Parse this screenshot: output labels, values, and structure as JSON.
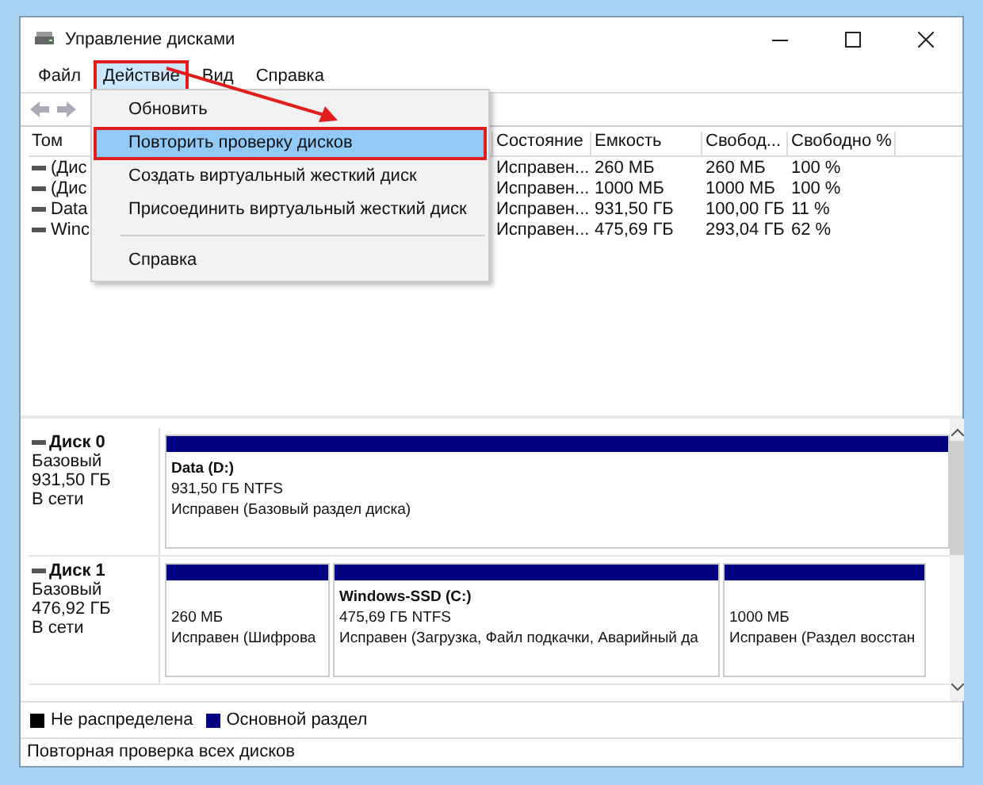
{
  "window": {
    "title": "Управление дисками"
  },
  "menu": [
    {
      "label": "Файл",
      "selected": false,
      "highlighted": false
    },
    {
      "label": "Действие",
      "selected": true,
      "highlighted": true
    },
    {
      "label": "Вид",
      "selected": false,
      "highlighted": false
    },
    {
      "label": "Справка",
      "selected": false,
      "highlighted": false
    }
  ],
  "dropdown": [
    {
      "kind": "item",
      "label": "Обновить",
      "selected": false,
      "highlighted": false
    },
    {
      "kind": "item",
      "label": "Повторить проверку дисков",
      "selected": true,
      "highlighted": true
    },
    {
      "kind": "item",
      "label": "Создать виртуальный жесткий диск",
      "selected": false,
      "highlighted": false
    },
    {
      "kind": "item",
      "label": "Присоединить виртуальный жесткий диск",
      "selected": false,
      "highlighted": false
    },
    {
      "kind": "separator"
    },
    {
      "kind": "item",
      "label": "Справка",
      "selected": false,
      "highlighted": false
    }
  ],
  "table": {
    "columns": [
      "Том",
      "Состояние",
      "Емкость",
      "Свобод...",
      "Свободно %"
    ],
    "rows": [
      [
        "(Дис",
        "Исправен...",
        "260 МБ",
        "260 МБ",
        "100 %"
      ],
      [
        "(Дис",
        "Исправен...",
        "1000 МБ",
        "1000 МБ",
        "100 %"
      ],
      [
        "Data",
        "Исправен...",
        "931,50 ГБ",
        "100,00 ГБ",
        "11 %"
      ],
      [
        "Winc",
        "Исправен...",
        "475,69 ГБ",
        "293,04 ГБ",
        "62 %"
      ]
    ]
  },
  "disks": [
    {
      "name": "Диск 0",
      "type": "Базовый",
      "size": "931,50 ГБ",
      "status": "В сети",
      "partitions": [
        {
          "title": "Data  (D:)",
          "size": "931,50 ГБ NTFS",
          "status": "Исправен (Базовый раздел диска)"
        }
      ]
    },
    {
      "name": "Диск 1",
      "type": "Базовый",
      "size": "476,92 ГБ",
      "status": "В сети",
      "partitions": [
        {
          "size": "260 МБ",
          "status": "Исправен (Шифрова"
        },
        {
          "title": "Windows-SSD  (C:)",
          "size": "475,69 ГБ NTFS",
          "status": "Исправен (Загрузка, Файл подкачки, Аварийный да"
        },
        {
          "size": "1000 МБ",
          "status": "Исправен (Раздел восстан"
        }
      ]
    }
  ],
  "legend": [
    {
      "label": "Не распределена",
      "color": "#000000"
    },
    {
      "label": "Основной раздел",
      "color": "#000080"
    }
  ],
  "status_bar": "Повторная проверка всех дисков"
}
